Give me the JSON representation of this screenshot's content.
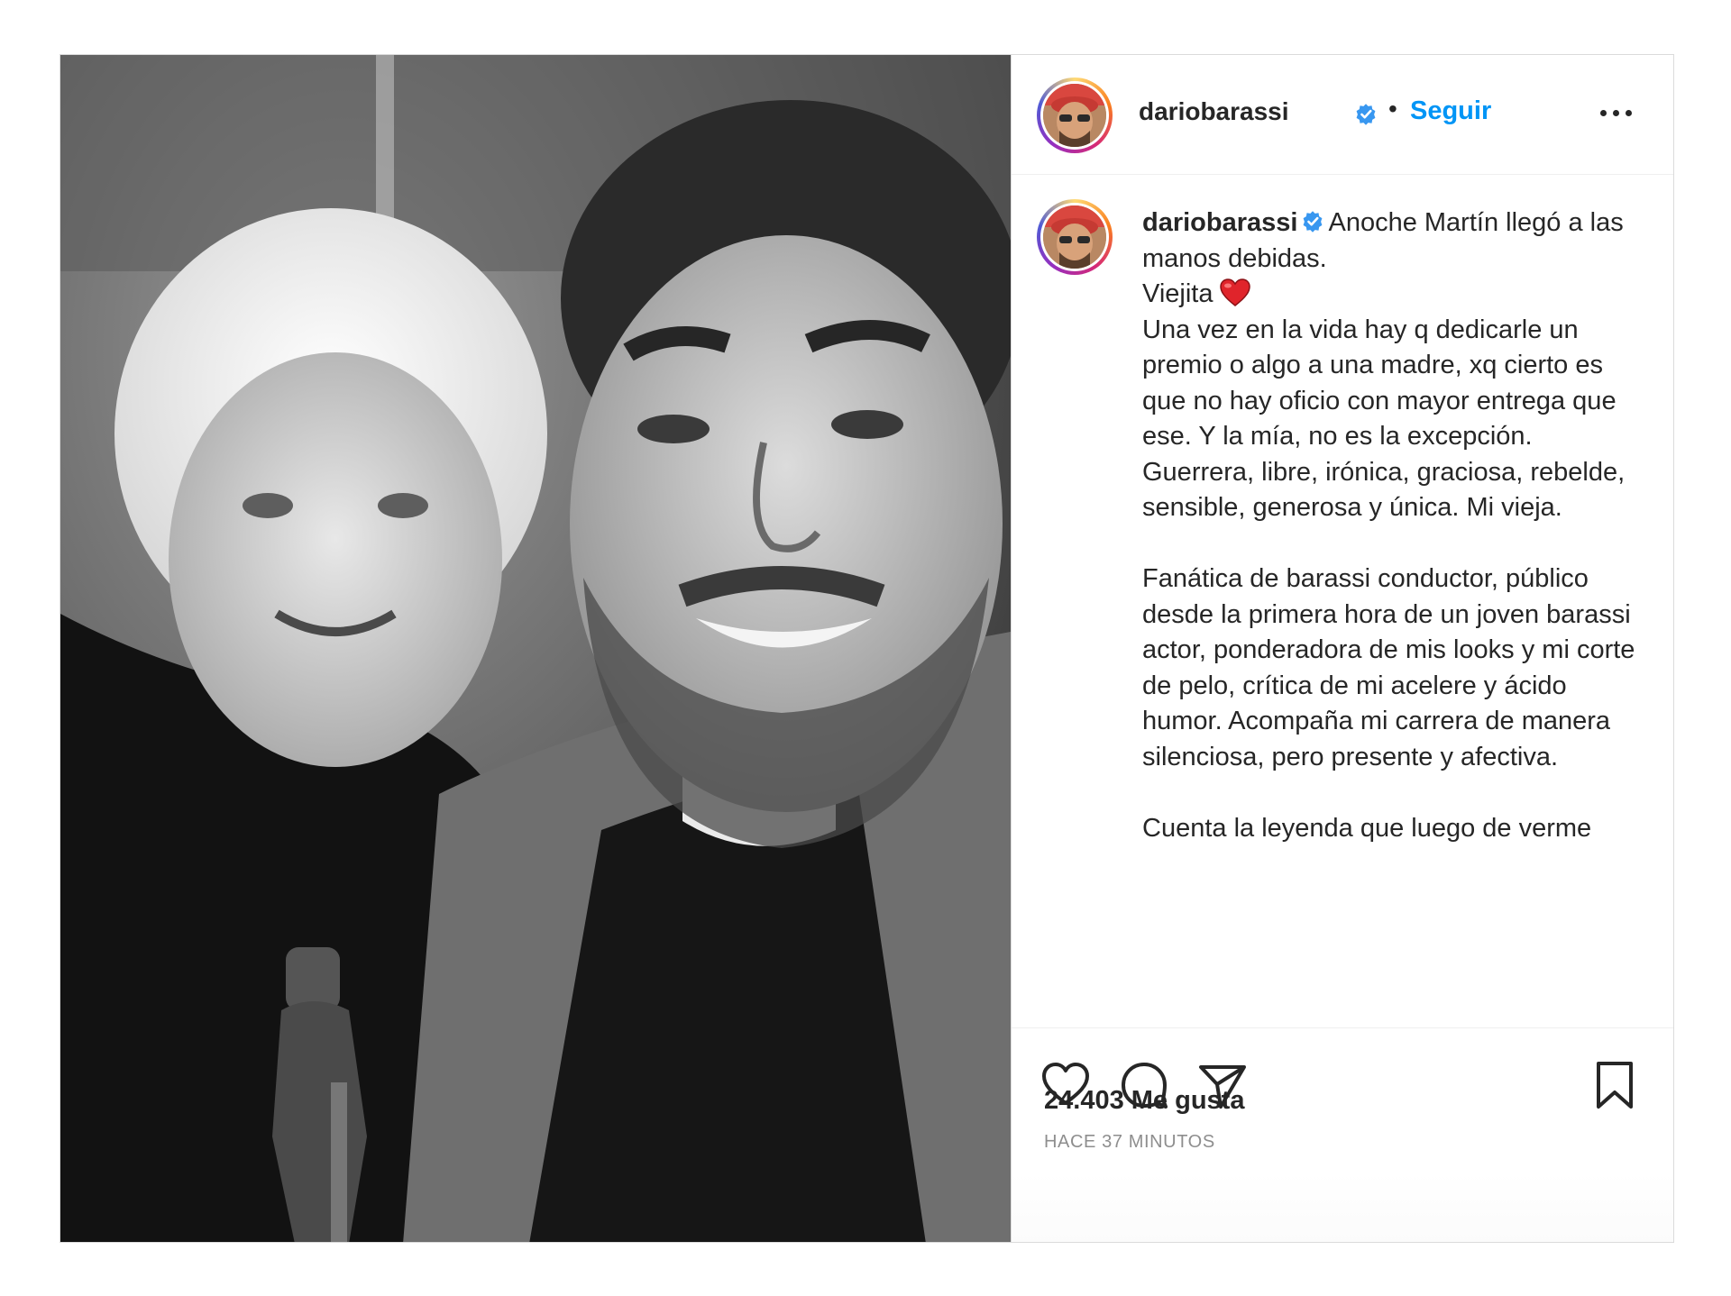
{
  "post": {
    "photo_alt": "Foto en blanco y negro",
    "header": {
      "username": "dariobarassi",
      "separator": "•",
      "follow_label": "Seguir"
    },
    "caption": {
      "username": "dariobarassi",
      "line1": "Anoche Martín llegó a las manos debidas.",
      "line2": "Viejita",
      "body": "Una vez en la vida hay q dedicarle un premio o algo a una madre, xq cierto es que no hay oficio con mayor entrega que ese. Y la mía, no es la excepción.\nGuerrera, libre, irónica, graciosa, rebelde, sensible, generosa y única. Mi vieja.\n\nFanática de barassi conductor, público desde la primera hora de un joven barassi actor, ponderadora de mis looks y mi corte de pelo, crítica de mi acelere y ácido humor. Acompaña mi carrera de manera silenciosa, pero presente y afectiva.\n\nCuenta la leyenda que luego de verme"
    },
    "likes": "24.403 Me gusta",
    "time": "HACE 37 MINUTOS",
    "icons": {
      "verified": "verified-badge-icon",
      "more": "more-options-icon",
      "heart_emoji": "red-heart-emoji",
      "like": "heart-outline-icon",
      "comment": "comment-bubble-icon",
      "share": "paper-plane-icon",
      "save": "bookmark-icon"
    },
    "colors": {
      "follow": "#0095f6",
      "verified": "#3897f0",
      "text": "#262626",
      "muted": "#8e8e8e"
    }
  }
}
